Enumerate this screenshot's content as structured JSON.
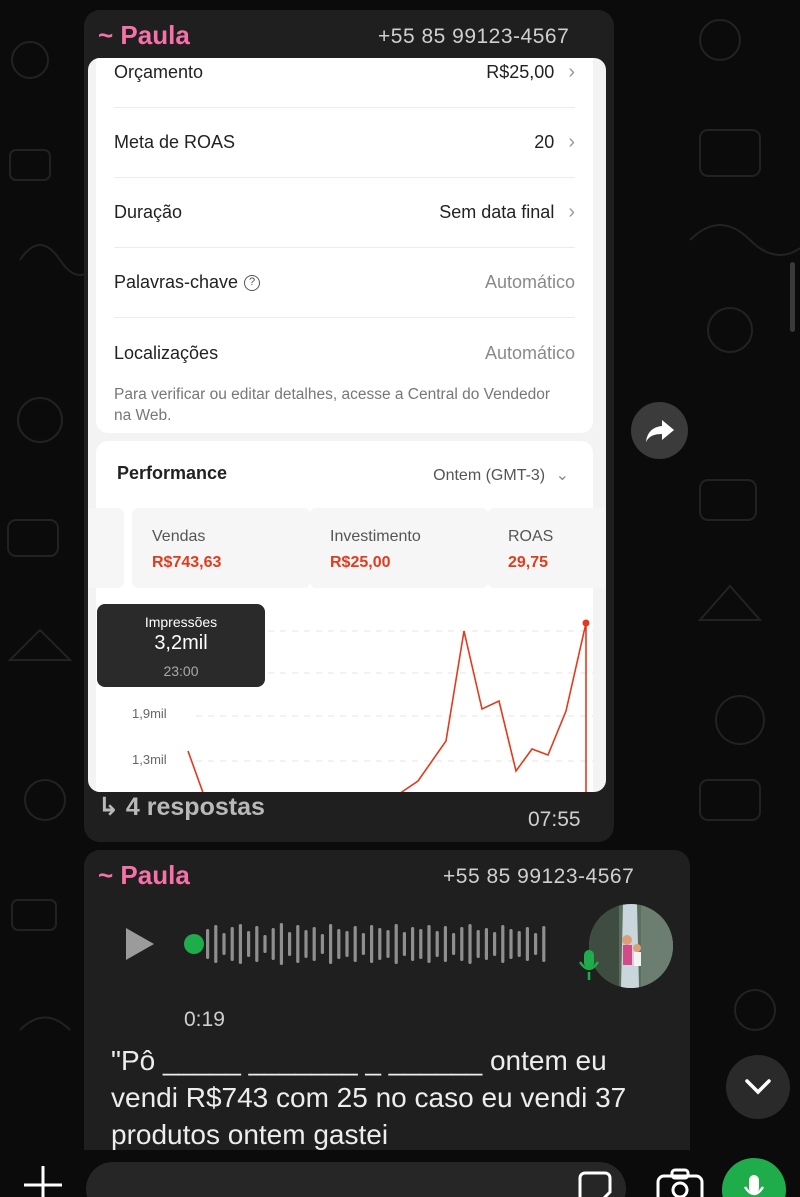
{
  "message1": {
    "sender_name": "~ Paula",
    "sender_phone": "+55 85 99123-4567",
    "screenshot": {
      "rows": [
        {
          "label": "Orçamento",
          "value": "R$25,00"
        },
        {
          "label": "Meta de ROAS",
          "value": "20"
        },
        {
          "label": "Duração",
          "value": "Sem data final"
        },
        {
          "label": "Palavras-chave",
          "value": "Automático"
        },
        {
          "label": "Localizações",
          "value": "Automático"
        }
      ],
      "note": "Para verificar ou editar detalhes, acesse a Central do Vendedor na Web.",
      "performance_title": "Performance",
      "performance_range": "Ontem (GMT-3)",
      "metrics": [
        {
          "label": "Vendas",
          "value": "R$743,63"
        },
        {
          "label": "Investimento",
          "value": "R$25,00"
        },
        {
          "label": "ROAS",
          "value": "29,75"
        }
      ],
      "tooltip": {
        "label": "Impressões",
        "value": "3,2mil",
        "time": "23:00"
      },
      "y_ticks": [
        "1,9mil",
        "1,3mil"
      ]
    },
    "replies": "4 respostas",
    "time": "07:55"
  },
  "message2": {
    "sender_name": "~ Paula",
    "sender_phone": "+55 85 99123-4567",
    "audio_duration": "0:19",
    "transcript": "\"Pô _____ _______ _ ______ ontem eu vendi R$743 com 25 no caso eu vendi 37 produtos ontem gastei"
  },
  "colors": {
    "accent_green": "#1fad4b",
    "sender_pink": "#f472a8",
    "metric_red": "#e33a1c"
  }
}
